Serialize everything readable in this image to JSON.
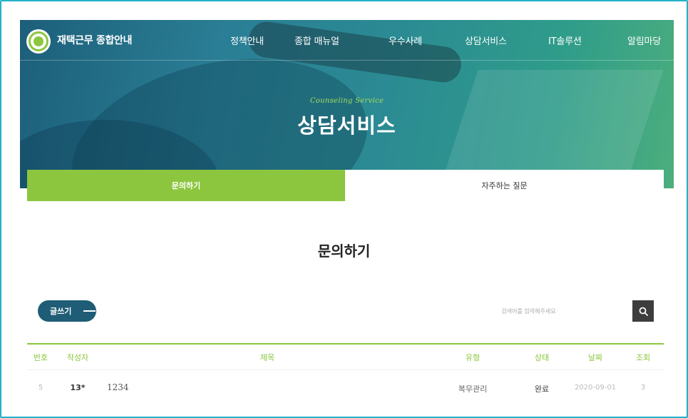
{
  "site": {
    "title": "재택근무 종합안내"
  },
  "nav": {
    "items": [
      "정책안내",
      "종합 매뉴얼",
      "우수사례",
      "상담서비스",
      "IT솔루션",
      "알림마당"
    ]
  },
  "hero": {
    "subtitle": "Counseling Service",
    "title": "상담서비스"
  },
  "tabs": {
    "active": "문의하기",
    "inactive": "자주하는 질문"
  },
  "section": {
    "title": "문의하기"
  },
  "toolbar": {
    "write_label": "글쓰기"
  },
  "search": {
    "placeholder": "검색어를 입력해주세요",
    "icon": "search-icon"
  },
  "table": {
    "headers": {
      "no": "번호",
      "author": "작성자",
      "title": "제목",
      "type": "유형",
      "status": "상태",
      "date": "날짜",
      "views": "조회"
    },
    "rows": [
      {
        "no": "5",
        "author": "13*",
        "title": "1234",
        "type": "복무관리",
        "status": "완료",
        "date": "2020-09-01",
        "views": "3"
      }
    ]
  },
  "colors": {
    "accent": "#8cc63f",
    "primary": "#1f5c75",
    "frame": "#25b2c7",
    "search_button": "#3d3d3d"
  }
}
